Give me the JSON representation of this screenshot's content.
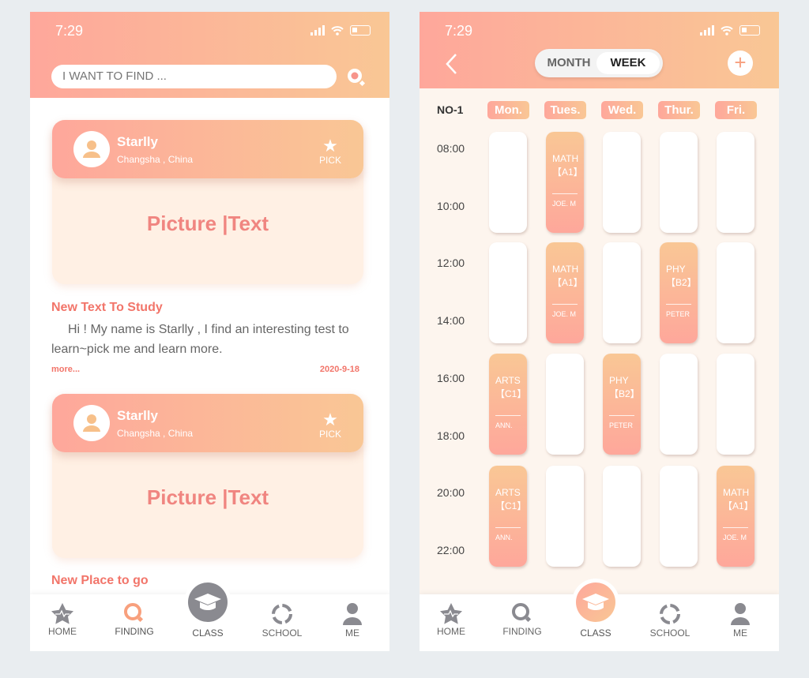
{
  "status": {
    "time": "7:29"
  },
  "left": {
    "search_placeholder": "I WANT TO FIND ...",
    "cards": [
      {
        "name": "Starlly",
        "location": "Changsha , China",
        "pick": "PICK",
        "content": "Picture |Text"
      },
      {
        "name": "Starlly",
        "location": "Changsha , China",
        "pick": "PICK",
        "content": "Picture |Text"
      }
    ],
    "section1": {
      "title": "New Text To Study",
      "body": "Hi ! My name is Starlly , I find an interesting test to learn~pick me and learn more.",
      "more": "more...",
      "date": "2020-9-18"
    },
    "section2": {
      "title": "New Place to go"
    },
    "active_tab": "FINDING"
  },
  "right": {
    "toggle": {
      "month": "MONTH",
      "week": "WEEK",
      "selected": "WEEK"
    },
    "week_label": "NO-1",
    "days": [
      "Mon.",
      "Tues.",
      "Wed.",
      "Thur.",
      "Fri."
    ],
    "times": [
      "08:00",
      "10:00",
      "12:00",
      "14:00",
      "16:00",
      "18:00",
      "20:00",
      "22:00"
    ],
    "schedule": [
      [
        null,
        {
          "subject": "MATH",
          "code": "【A1】",
          "teacher": "JOE. M"
        },
        null,
        null,
        null
      ],
      [
        null,
        {
          "subject": "MATH",
          "code": "【A1】",
          "teacher": "JOE. M"
        },
        null,
        {
          "subject": "PHY",
          "code": "【B2】",
          "teacher": "PETER"
        },
        null
      ],
      [
        {
          "subject": "ARTS",
          "code": "【C1】",
          "teacher": "ANN."
        },
        null,
        {
          "subject": "PHY",
          "code": "【B2】",
          "teacher": "PETER"
        },
        null,
        null
      ],
      [
        {
          "subject": "ARTS",
          "code": "【C1】",
          "teacher": "ANN."
        },
        null,
        null,
        null,
        {
          "subject": "MATH",
          "code": "【A1】",
          "teacher": "JOE. M"
        }
      ]
    ],
    "active_tab": "CLASS"
  },
  "tabs": [
    "HOME",
    "FINDING",
    "CLASS",
    "SCHOOL",
    "ME"
  ],
  "colors": {
    "accent_start": "#fea79b",
    "accent_end": "#f9c795",
    "text_accent": "#f2756a",
    "inactive_icon": "#8a8a90"
  }
}
